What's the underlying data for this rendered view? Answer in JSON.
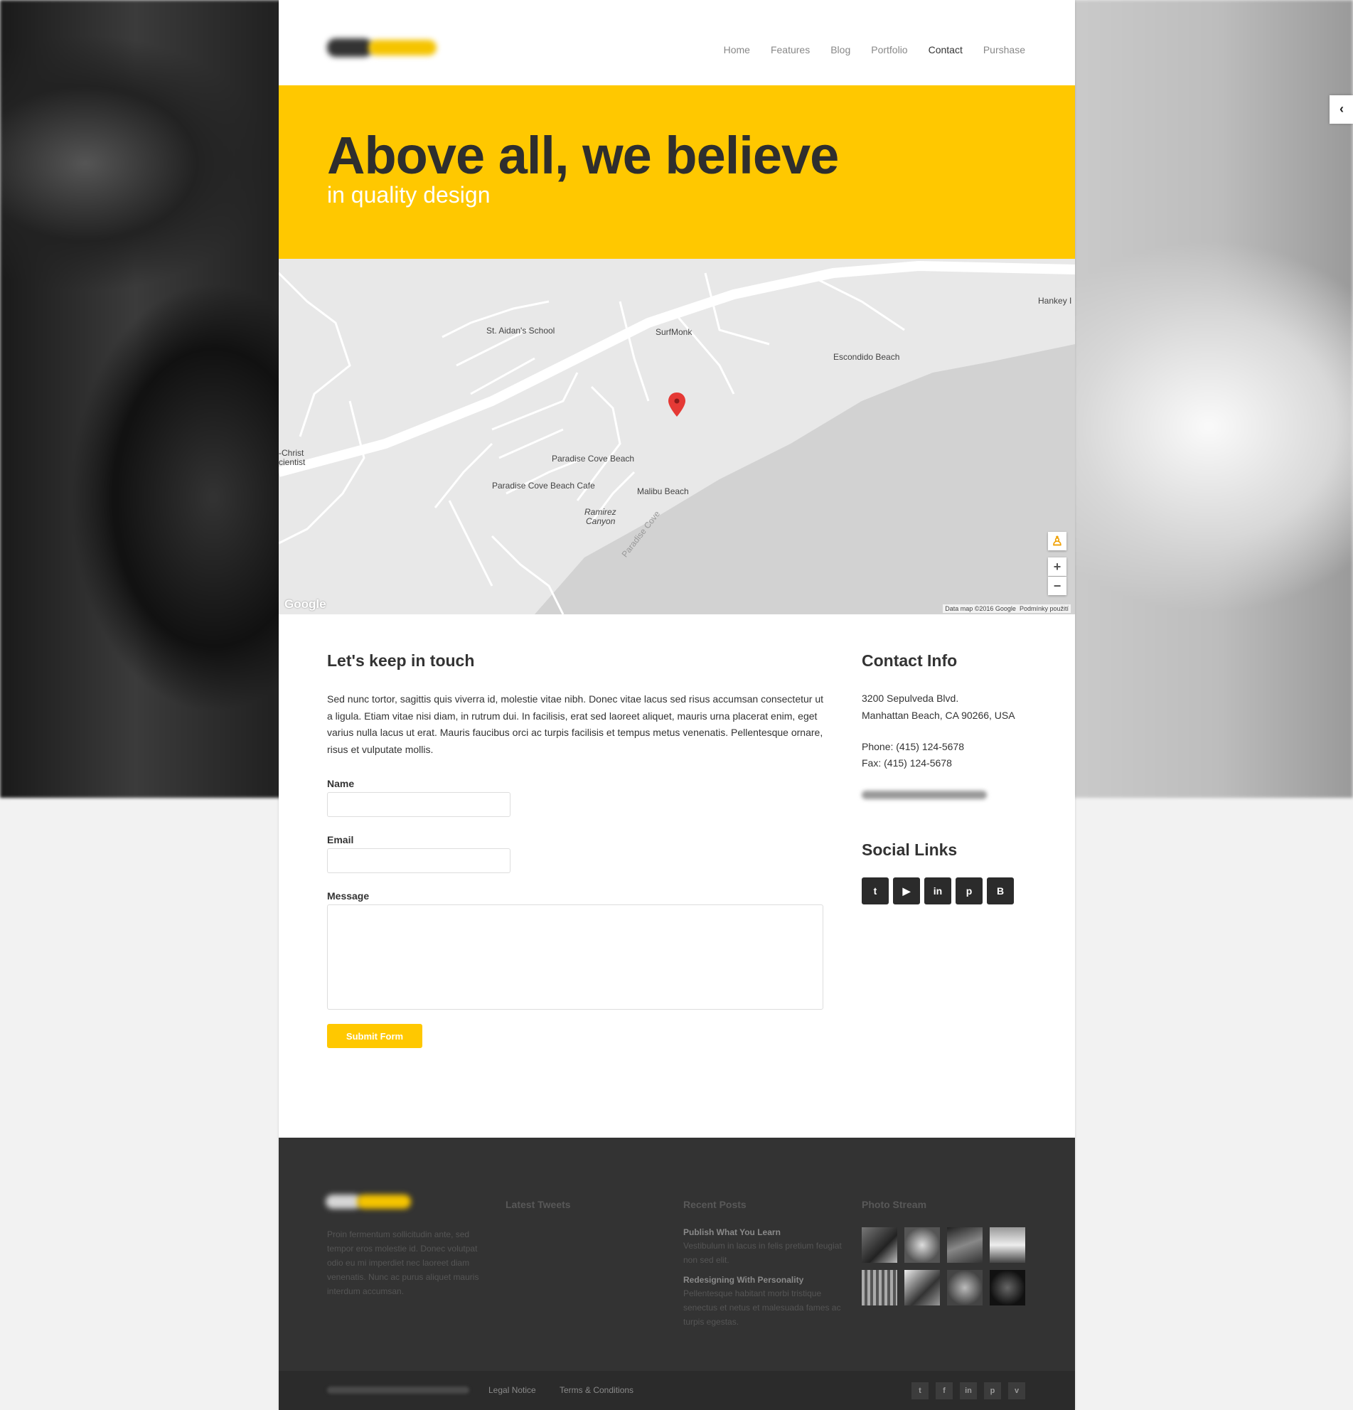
{
  "nav": {
    "items": [
      "Home",
      "Features",
      "Blog",
      "Portfolio",
      "Contact",
      "Purshase"
    ],
    "active": "Contact"
  },
  "hero": {
    "title": "Above all, we believe",
    "subtitle": "in quality design"
  },
  "map": {
    "labels": [
      "St. Aidan's School",
      "SurfMonk",
      "Escondido Beach",
      "Hankey I",
      "-Christ",
      "cientist",
      "Paradise Cove Beach",
      "Paradise Cove Beach Cafe",
      "Malibu Beach",
      "Ramirez",
      "Canyon",
      "Paradise Cove"
    ],
    "zoom_in": "+",
    "zoom_out": "−",
    "google": "Google",
    "attribution": "Data map ©2016 Google",
    "terms": "Podmínky použití"
  },
  "contact_form": {
    "heading": "Let's keep in touch",
    "intro": "Sed nunc tortor, sagittis quis viverra id, molestie vitae nibh. Donec vitae lacus sed risus accumsan consectetur ut a ligula. Etiam vitae nisi diam, in rutrum dui. In facilisis, erat sed laoreet aliquet, mauris urna placerat enim, eget varius nulla lacus ut erat. Mauris faucibus orci ac turpis facilisis et tempus metus venenatis. Pellentesque ornare, risus et vulputate mollis.",
    "name_label": "Name",
    "email_label": "Email",
    "message_label": "Message",
    "submit_label": "Submit Form"
  },
  "contact_info": {
    "heading": "Contact Info",
    "address_line1": "3200 Sepulveda Blvd.",
    "address_line2": "Manhattan Beach, CA 90266, USA",
    "phone": "Phone: (415) 124-5678",
    "fax": "Fax: (415) 124-5678",
    "social_heading": "Social Links",
    "social_icons": [
      "twitter-icon",
      "youtube-icon",
      "linkedin-icon",
      "pinterest-icon",
      "blogger-icon"
    ]
  },
  "footer": {
    "about": "Proin fermentum sollicitudin ante, sed tempor eros molestie id. Donec volutpat odio eu mi imperdiet nec laoreet diam venenatis. Nunc ac purus aliquet mauris interdum accumsan.",
    "tweets_heading": "Latest Tweets",
    "posts_heading": "Recent Posts",
    "posts": [
      {
        "title": "Publish What You Learn",
        "text": "Vestibulum in lacus in felis pretium feugiat non sed elit."
      },
      {
        "title": "Redesigning With Personality",
        "text": "Pellentesque habitant morbi tristique senectus et netus et malesuada fames ac turpis egestas."
      }
    ],
    "photos_heading": "Photo Stream",
    "legal": "Legal Notice",
    "terms": "Terms & Conditions",
    "social_icons": [
      "twitter-icon",
      "facebook-icon",
      "linkedin-icon",
      "pinterest-icon",
      "vimeo-icon"
    ]
  },
  "colors": {
    "accent": "#ffc800",
    "dark": "#333333",
    "footer": "#333333"
  }
}
